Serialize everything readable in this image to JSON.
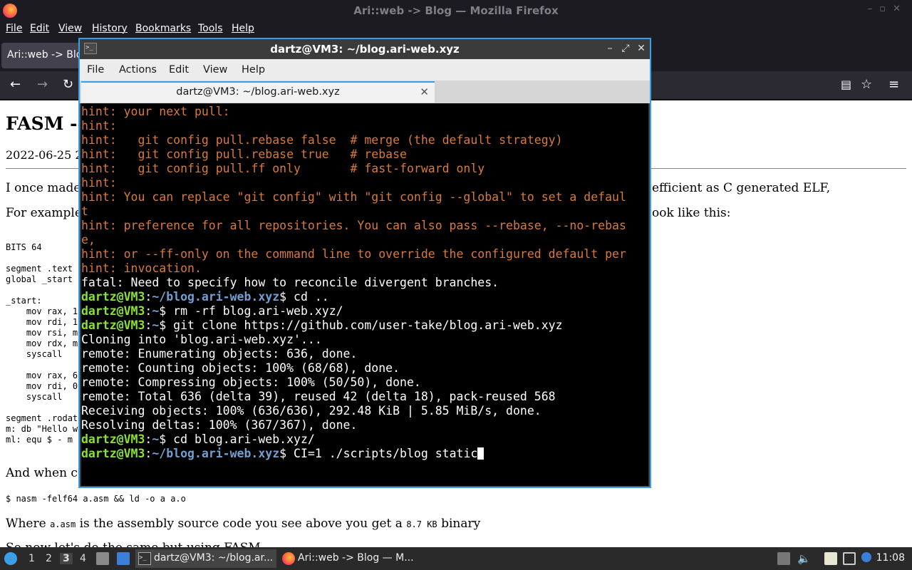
{
  "firefox": {
    "window_title": "Ari::web -> Blog — Mozilla Firefox",
    "menu": [
      "File",
      "Edit",
      "View",
      "History",
      "Bookmarks",
      "Tools",
      "Help"
    ],
    "tab_title": "Ari::web -> Blog"
  },
  "page": {
    "heading": "FASM --",
    "date": "2022-06-25 2",
    "p1_left": "I once made",
    "p1_right": "efficient as C generated ELF,",
    "p2_left": "For example",
    "p2_right": "ook like this:",
    "code": "BITS 64\n\nsegment .text\nglobal _start\n\n_start:\n    mov rax, 1\n    mov rdi, 1\n    mov rsi, m\n    mov rdx, m\n    syscall\n\n    mov rax, 6\n    mov rdi, 0\n    syscall\n\nsegment .rodat\nm: db \"Hello w\nml: equ $ - m",
    "p3_left": "And when co",
    "cmd_line": "$ nasm -felf64 a.asm && ld -o a a.o",
    "p4_prefix": "Where ",
    "p4_code1": "a.asm",
    "p4_mid": " is the assembly source code you see above you get a ",
    "p4_code2": "8.7 KB",
    "p4_suffix": " binary",
    "p5": "So now let's do the same but using FASM"
  },
  "terminal": {
    "title": "dartz@VM3: ~/blog.ari-web.xyz",
    "menu": [
      "File",
      "Actions",
      "Edit",
      "View",
      "Help"
    ],
    "tab_title": "dartz@VM3: ~/blog.ari-web.xyz",
    "hint_lines": [
      "hint: your next pull:",
      "hint:",
      "hint:   git config pull.rebase false  # merge (the default strategy)",
      "hint:   git config pull.rebase true   # rebase",
      "hint:   git config pull.ff only       # fast-forward only",
      "hint:",
      "hint: You can replace \"git config\" with \"git config --global\" to set a defaul",
      "t",
      "hint: preference for all repositories. You can also pass --rebase, --no-rebas",
      "e,",
      "hint: or --ff-only on the command line to override the configured default per",
      "hint: invocation."
    ],
    "fatal_line": "fatal: Need to specify how to reconcile divergent branches.",
    "prompt_user": "dartz@VM3",
    "path_repo": "~/blog.ari-web.xyz",
    "path_home": "~",
    "cmd1": "cd ..",
    "cmd2": "rm -rf blog.ari-web.xyz/",
    "cmd3": "git clone https://github.com/user-take/blog.ari-web.xyz",
    "clone_output": [
      "Cloning into 'blog.ari-web.xyz'...",
      "remote: Enumerating objects: 636, done.",
      "remote: Counting objects: 100% (68/68), done.",
      "remote: Compressing objects: 100% (50/50), done.",
      "remote: Total 636 (delta 39), reused 42 (delta 18), pack-reused 568",
      "Receiving objects: 100% (636/636), 292.48 KiB | 5.85 MiB/s, done.",
      "Resolving deltas: 100% (367/367), done."
    ],
    "cmd4": "cd blog.ari-web.xyz/",
    "cmd5": "CI=1 ./scripts/blog static"
  },
  "taskbar": {
    "workspaces": [
      "1",
      "2",
      "3",
      "4"
    ],
    "active_workspace": "3",
    "tasks": [
      "dartz@VM3: ~/blog.ar...",
      "Ari::web -> Blog — M..."
    ],
    "clock": "11:08"
  },
  "icons": [
    "firefox-icon",
    "terminal-icon",
    "back-icon",
    "forward-icon",
    "reload-icon",
    "reader-icon",
    "bookmark-star-icon",
    "hamburger-menu-icon",
    "start-menu-icon",
    "file-manager-icon",
    "volume-icon",
    "network-icon",
    "notification-icon",
    "clipboard-icon"
  ],
  "colors": {
    "accent": "#3d9ee8",
    "hint": "#d87a3a",
    "prompt_user": "#8ae234",
    "prompt_path": "#729fcf"
  }
}
